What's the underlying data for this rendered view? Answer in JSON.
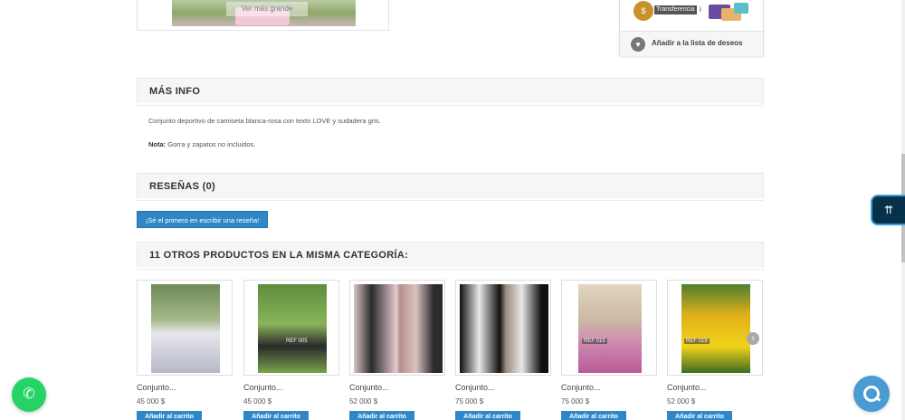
{
  "gallery": {
    "view_larger_label": "Ver más grande"
  },
  "payment": {
    "transfer_label": "Transferencia",
    "info_glyph": "i",
    "icon": "coin-icon",
    "wishlist_label": "Añadir a la lista de deseos",
    "wishlist_icon": "heart-icon"
  },
  "more_info": {
    "title": "MÁS INFO",
    "description": "Conjunto deportivo de camiseta blanca-rosa con texto LOVE y sudadera gris.",
    "note_label": "Nota:",
    "note_text": " Gorra y zapatos no incluidos."
  },
  "reviews": {
    "title": "RESEÑAS (0)",
    "first_review_button": "¡Sé el primero en escribir una reseña!"
  },
  "related": {
    "title": "11 OTROS PRODUCTOS EN LA MISMA CATEGORÍA:",
    "products": [
      {
        "name": "Conjunto...",
        "price": "45 000 $",
        "cart_label": "Añadir al carrito",
        "ref": ""
      },
      {
        "name": "Conjunto...",
        "price": "45 000 $",
        "cart_label": "Añadir al carrito",
        "ref": "REF 005"
      },
      {
        "name": "Conjunto...",
        "price": "52 000 $",
        "cart_label": "Añadir al carrito",
        "ref": ""
      },
      {
        "name": "Conjunto...",
        "price": "75 000 $",
        "cart_label": "Añadir al carrito",
        "ref": ""
      },
      {
        "name": "Conjunto...",
        "price": "75 000 $",
        "cart_label": "Añadir al carrito",
        "ref": "REF 015"
      },
      {
        "name": "Conjunto...",
        "price": "52 000 $",
        "cart_label": "Añadir al carrito",
        "ref": "REF 019"
      }
    ],
    "next_glyph": "›"
  },
  "floating": {
    "back_to_top_glyph": "⇈",
    "whatsapp_glyph": "✆",
    "chat_icon": "chat-icon"
  },
  "colors": {
    "accent": "#2f87c8",
    "whatsapp": "#25d366",
    "back_top_bg": "#07314a"
  }
}
